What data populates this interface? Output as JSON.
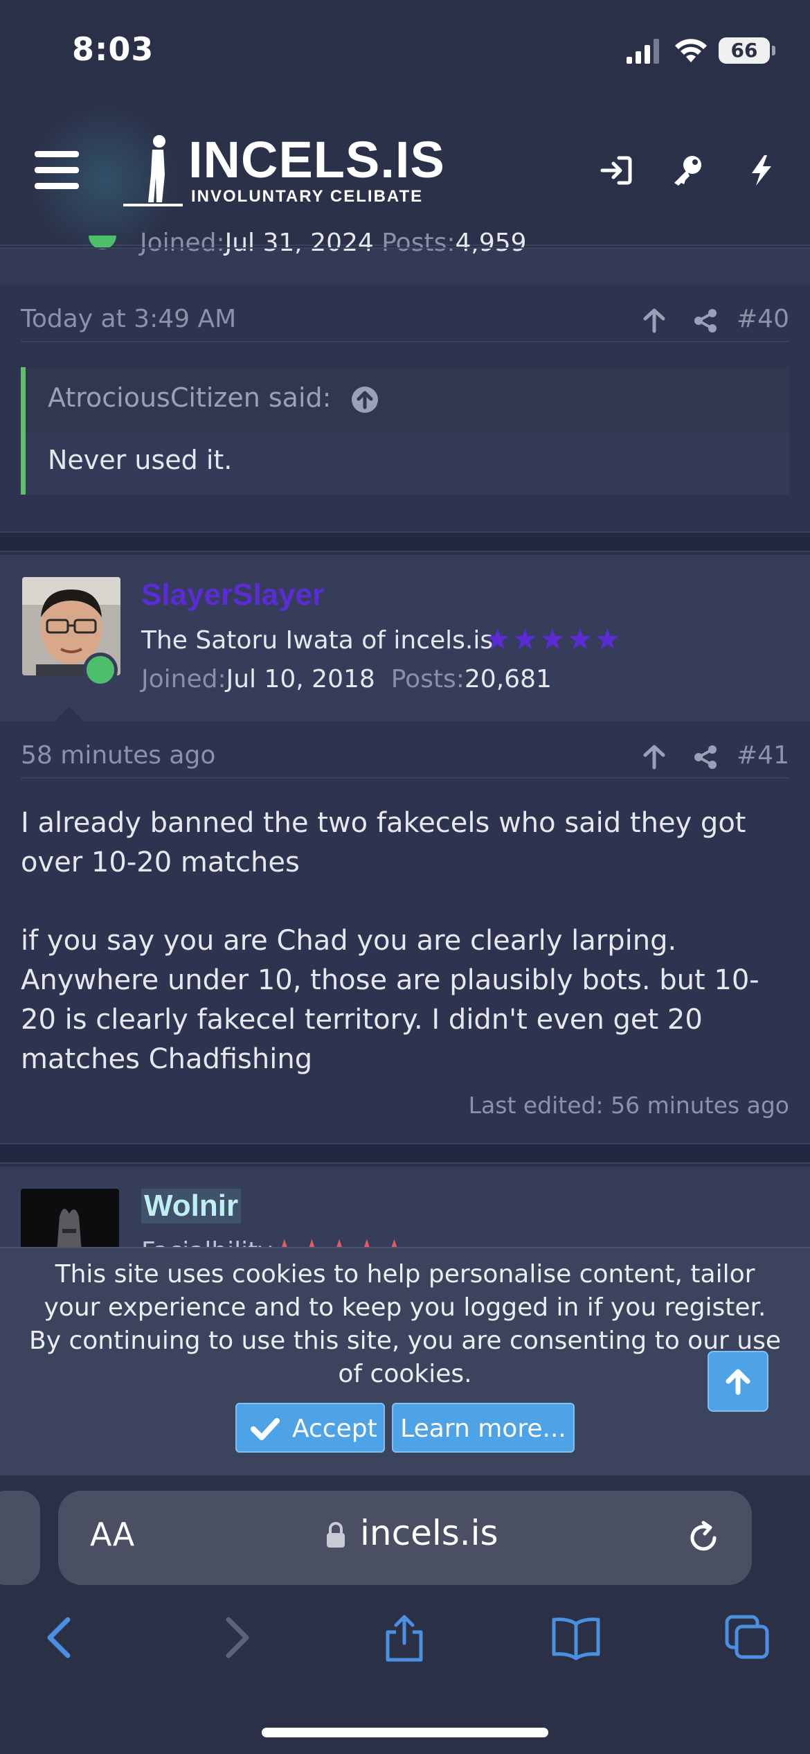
{
  "status": {
    "time": "8:03",
    "battery": "66"
  },
  "header": {
    "logo_title": "INCELS.IS",
    "logo_subtitle": "INVOLUNTARY CELIBATE"
  },
  "prev_user": {
    "joined_label": "Joined:",
    "joined_date": "Jul 31, 2024",
    "posts_label": "Posts:",
    "posts_count": "4,959"
  },
  "post40": {
    "time": "Today at 3:49 AM",
    "number": "#40",
    "quote_author": "AtrociousCitizen said:",
    "quote_text": "Never used it."
  },
  "post41": {
    "username": "SlayerSlayer",
    "username_color": "#5b2bd6",
    "user_title": "The Satoru Iwata of incels.is",
    "stars": "★★★★★",
    "stars_color": "#5b2bd6",
    "joined_label": "Joined:",
    "joined_date": "Jul 10, 2018",
    "posts_label": "Posts:",
    "posts_count": "20,681",
    "time": "58 minutes ago",
    "number": "#41",
    "paragraph1": "I already banned the two fakecels who said they got over 10-20 matches",
    "paragraph2": "if you say you are Chad you are clearly larping. Anywhere under 10, those are plausibly bots. but 10-20 is clearly fakecel territory. I didn't even get 20 matches Chadfishing",
    "last_edited": "Last edited: 56 minutes ago"
  },
  "post42": {
    "username": "Wolnir",
    "username_color": "#bfeff2",
    "user_title": "Facialbility",
    "stars": "★★★★★",
    "stars_color": "#e85a5a"
  },
  "cookie": {
    "text1": "This site uses cookies to help personalise content, tailor your experience and to keep you logged in if you register.",
    "text2": "By continuing to use this site, you are consenting to our use of cookies.",
    "accept": "Accept",
    "learn_more": "Learn more..."
  },
  "browser": {
    "aa": "AA",
    "url": "incels.is"
  },
  "icons": [
    "menu-icon",
    "login-icon",
    "key-icon",
    "bolt-icon",
    "upvote-icon",
    "share-icon",
    "arrow-up-icon",
    "check-icon",
    "lock-icon",
    "reload-icon",
    "back-icon",
    "forward-icon",
    "share-sheet-icon",
    "bookmarks-icon",
    "tabs-icon"
  ]
}
